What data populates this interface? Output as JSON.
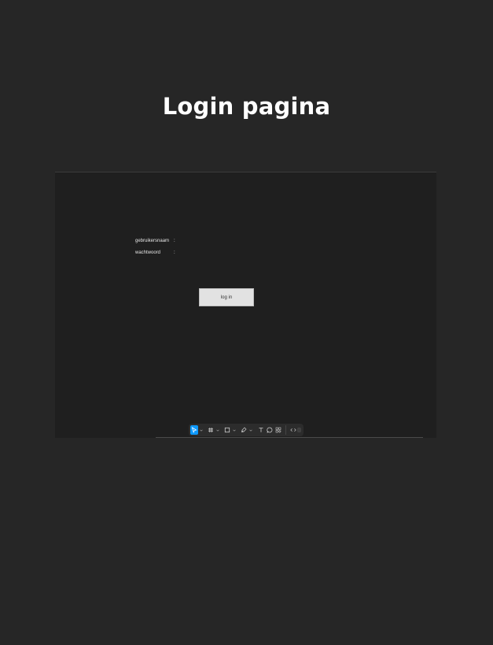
{
  "page": {
    "title": "Login pagina"
  },
  "login_form": {
    "username_label": "gebruikersnaam",
    "username_separator": ":",
    "password_label": "wachtwoord",
    "password_separator": ":",
    "submit_label": "log in"
  },
  "toolbar": {
    "tools": [
      {
        "name": "move-tool",
        "icon": "cursor-icon",
        "active": true
      },
      {
        "name": "frame-tool",
        "icon": "hash-icon"
      },
      {
        "name": "shape-tool",
        "icon": "square-icon"
      },
      {
        "name": "pen-tool",
        "icon": "pen-icon"
      },
      {
        "name": "text-tool",
        "icon": "text-icon"
      },
      {
        "name": "comment-tool",
        "icon": "comment-icon"
      },
      {
        "name": "resources-tool",
        "icon": "components-icon"
      },
      {
        "name": "dev-mode-toggle",
        "icon": "code-icon"
      }
    ],
    "accent": "#0d99ff"
  },
  "colors": {
    "page_background": "#262626",
    "canvas_background": "#1f1f1f",
    "button_background": "#e2e2e2"
  }
}
